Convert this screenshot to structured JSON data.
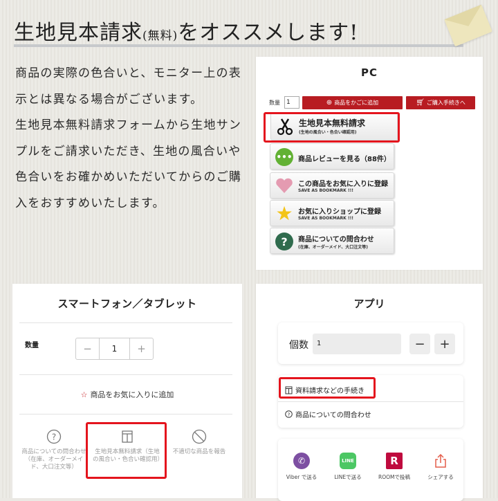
{
  "header": {
    "title_main": "生地見本請求",
    "title_paren": "(無料)",
    "title_rest": "をオススメします!"
  },
  "intro": {
    "p1": "商品の実際の色合いと、モニター上の表示とは異なる場合がございます。",
    "p2": "生地見本無料請求フォームから生地サンプルをご請求いただき、生地の風合いや色合いをお確かめいただいてからのご購入をおすすめいたします。"
  },
  "pc": {
    "title": "PC",
    "qty_label": "数量",
    "qty_value": "1",
    "cart_btn": "商品をかごに追加",
    "buy_btn": "ご購入手続きへ",
    "buttons": [
      {
        "l1": "生地見本無料請求",
        "l2": "(生地の風合い・色合い確認用)"
      },
      {
        "l1": "商品レビューを見る（88件）",
        "l2": ""
      },
      {
        "l1": "この商品をお気に入りに登録",
        "l2": "SAVE AS BOOKMARK !!!"
      },
      {
        "l1": "お気に入りショップに登録",
        "l2": "SAVE AS BOOKMARK !!!"
      },
      {
        "l1": "商品についての問合わせ",
        "l2": "(在庫、オーダーメイド、大口注文等)"
      }
    ]
  },
  "smartphone": {
    "title": "スマートフォン／タブレット",
    "qty_label": "数量",
    "minus": "−",
    "qty_value": "1",
    "plus": "+",
    "fav": "商品をお気に入りに追加",
    "options": [
      "商品についての問合わせ（在庫、オーダーメイド、大口注文等）",
      "生地見本無料請求（生地の風合い・色合い確認用）",
      "不適切な商品を報告"
    ]
  },
  "app": {
    "title": "アプリ",
    "qty_label": "個数",
    "qty_value": "1",
    "minus": "−",
    "plus": "+",
    "doc_request": "資料請求などの手続き",
    "inquiry": "商品についての問合わせ",
    "share": [
      {
        "label": "Viber で送る",
        "color": "#7d4fa2"
      },
      {
        "label": "LINEで送る",
        "color": "#4cc764"
      },
      {
        "label": "ROOMで投稿",
        "color": "#bf0a3e"
      },
      {
        "label": "シェアする",
        "color": "#e45d4a"
      }
    ]
  }
}
